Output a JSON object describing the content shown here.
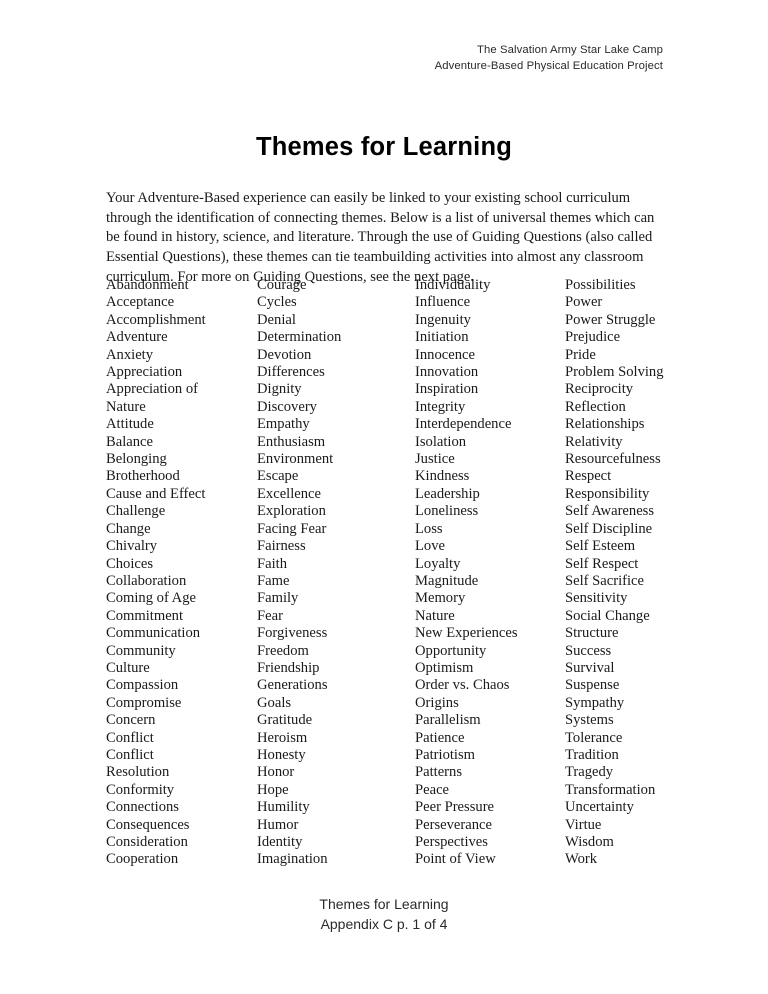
{
  "document": {
    "header_lines": [
      "The Salvation Army Star Lake Camp",
      "Adventure-Based Physical Education Project"
    ],
    "title": "Themes for Learning",
    "intro_paragraph": "Your Adventure-Based experience can easily be linked to your existing school curriculum through the identification of connecting themes. Below is a list of universal themes which can be found in history, science, and literature. Through the use of Guiding Questions (also called Essential Questions), these themes can tie teambuilding activities into almost any classroom curriculum. For more on Guiding Questions, see the next page.",
    "footer_lines": [
      "Themes for Learning",
      "Appendix C p. 1 of 4"
    ]
  },
  "themes": {
    "column1": [
      "Abandonment",
      "Acceptance",
      "Accomplishment",
      "Adventure",
      "Anxiety",
      "Appreciation",
      "Appreciation of",
      "Nature",
      "Attitude",
      "Balance",
      "Belonging",
      "Brotherhood",
      "Cause and Effect",
      "Challenge",
      "Change",
      "Chivalry",
      "Choices",
      "Collaboration",
      "Coming of Age",
      "Commitment",
      "Communication",
      "Community",
      "Culture",
      "Compassion",
      "Compromise",
      "Concern",
      "Conflict",
      "Conflict",
      "Resolution",
      "Conformity",
      "Connections",
      "Consequences",
      "Consideration",
      "Cooperation"
    ],
    "column2": [
      "Courage",
      "Cycles",
      "Denial",
      "Determination",
      "Devotion",
      "Differences",
      "Dignity",
      "Discovery",
      "Empathy",
      "Enthusiasm",
      "Environment",
      "Escape",
      "Excellence",
      "Exploration",
      "Facing Fear",
      "Fairness",
      "Faith",
      "Fame",
      "Family",
      "Fear",
      "Forgiveness",
      "Freedom",
      "Friendship",
      "Generations",
      "Goals",
      "Gratitude",
      "Heroism",
      "Honesty",
      "Honor",
      "Hope",
      "Humility",
      "Humor",
      "Identity",
      "Imagination"
    ],
    "column3": [
      "Individuality",
      "Influence",
      "Ingenuity",
      "Initiation",
      "Innocence",
      "Innovation",
      "Inspiration",
      "Integrity",
      "Interdependence",
      "Isolation",
      "Justice",
      "Kindness",
      "Leadership",
      "Loneliness",
      "Loss",
      "Love",
      "Loyalty",
      "Magnitude",
      "Memory",
      "Nature",
      "New Experiences",
      "Opportunity",
      "Optimism",
      "Order vs. Chaos",
      "Origins",
      "Parallelism",
      "Patience",
      "Patriotism",
      "Patterns",
      "Peace",
      "Peer Pressure",
      "Perseverance",
      "Perspectives",
      "Point of View"
    ],
    "column4": [
      "Possibilities",
      "Power",
      "Power Struggle",
      "Prejudice",
      "Pride",
      "Problem Solving",
      "Reciprocity",
      "Reflection",
      "Relationships",
      "Relativity",
      "Resourcefulness",
      "Respect",
      "Responsibility",
      "Self Awareness",
      "Self Discipline",
      "Self Esteem",
      "Self Respect",
      "Self Sacrifice",
      "Sensitivity",
      "Social Change",
      "Structure",
      "Success",
      "Survival",
      "Suspense",
      "Sympathy",
      "Systems",
      "Tolerance",
      "Tradition",
      "Tragedy",
      "Transformation",
      "Uncertainty",
      "Virtue",
      "Wisdom",
      "Work"
    ]
  }
}
